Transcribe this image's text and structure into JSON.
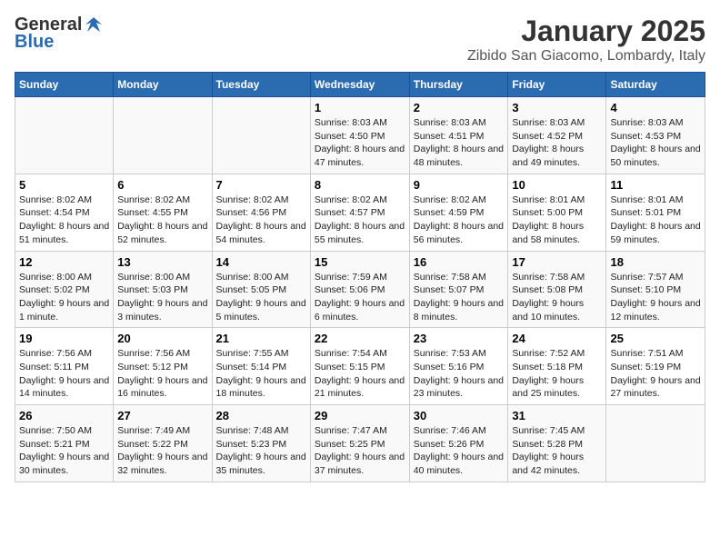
{
  "logo": {
    "general": "General",
    "blue": "Blue"
  },
  "title": "January 2025",
  "subtitle": "Zibido San Giacomo, Lombardy, Italy",
  "days_of_week": [
    "Sunday",
    "Monday",
    "Tuesday",
    "Wednesday",
    "Thursday",
    "Friday",
    "Saturday"
  ],
  "weeks": [
    [
      {
        "num": "",
        "info": ""
      },
      {
        "num": "",
        "info": ""
      },
      {
        "num": "",
        "info": ""
      },
      {
        "num": "1",
        "info": "Sunrise: 8:03 AM\nSunset: 4:50 PM\nDaylight: 8 hours and 47 minutes."
      },
      {
        "num": "2",
        "info": "Sunrise: 8:03 AM\nSunset: 4:51 PM\nDaylight: 8 hours and 48 minutes."
      },
      {
        "num": "3",
        "info": "Sunrise: 8:03 AM\nSunset: 4:52 PM\nDaylight: 8 hours and 49 minutes."
      },
      {
        "num": "4",
        "info": "Sunrise: 8:03 AM\nSunset: 4:53 PM\nDaylight: 8 hours and 50 minutes."
      }
    ],
    [
      {
        "num": "5",
        "info": "Sunrise: 8:02 AM\nSunset: 4:54 PM\nDaylight: 8 hours and 51 minutes."
      },
      {
        "num": "6",
        "info": "Sunrise: 8:02 AM\nSunset: 4:55 PM\nDaylight: 8 hours and 52 minutes."
      },
      {
        "num": "7",
        "info": "Sunrise: 8:02 AM\nSunset: 4:56 PM\nDaylight: 8 hours and 54 minutes."
      },
      {
        "num": "8",
        "info": "Sunrise: 8:02 AM\nSunset: 4:57 PM\nDaylight: 8 hours and 55 minutes."
      },
      {
        "num": "9",
        "info": "Sunrise: 8:02 AM\nSunset: 4:59 PM\nDaylight: 8 hours and 56 minutes."
      },
      {
        "num": "10",
        "info": "Sunrise: 8:01 AM\nSunset: 5:00 PM\nDaylight: 8 hours and 58 minutes."
      },
      {
        "num": "11",
        "info": "Sunrise: 8:01 AM\nSunset: 5:01 PM\nDaylight: 8 hours and 59 minutes."
      }
    ],
    [
      {
        "num": "12",
        "info": "Sunrise: 8:00 AM\nSunset: 5:02 PM\nDaylight: 9 hours and 1 minute."
      },
      {
        "num": "13",
        "info": "Sunrise: 8:00 AM\nSunset: 5:03 PM\nDaylight: 9 hours and 3 minutes."
      },
      {
        "num": "14",
        "info": "Sunrise: 8:00 AM\nSunset: 5:05 PM\nDaylight: 9 hours and 5 minutes."
      },
      {
        "num": "15",
        "info": "Sunrise: 7:59 AM\nSunset: 5:06 PM\nDaylight: 9 hours and 6 minutes."
      },
      {
        "num": "16",
        "info": "Sunrise: 7:58 AM\nSunset: 5:07 PM\nDaylight: 9 hours and 8 minutes."
      },
      {
        "num": "17",
        "info": "Sunrise: 7:58 AM\nSunset: 5:08 PM\nDaylight: 9 hours and 10 minutes."
      },
      {
        "num": "18",
        "info": "Sunrise: 7:57 AM\nSunset: 5:10 PM\nDaylight: 9 hours and 12 minutes."
      }
    ],
    [
      {
        "num": "19",
        "info": "Sunrise: 7:56 AM\nSunset: 5:11 PM\nDaylight: 9 hours and 14 minutes."
      },
      {
        "num": "20",
        "info": "Sunrise: 7:56 AM\nSunset: 5:12 PM\nDaylight: 9 hours and 16 minutes."
      },
      {
        "num": "21",
        "info": "Sunrise: 7:55 AM\nSunset: 5:14 PM\nDaylight: 9 hours and 18 minutes."
      },
      {
        "num": "22",
        "info": "Sunrise: 7:54 AM\nSunset: 5:15 PM\nDaylight: 9 hours and 21 minutes."
      },
      {
        "num": "23",
        "info": "Sunrise: 7:53 AM\nSunset: 5:16 PM\nDaylight: 9 hours and 23 minutes."
      },
      {
        "num": "24",
        "info": "Sunrise: 7:52 AM\nSunset: 5:18 PM\nDaylight: 9 hours and 25 minutes."
      },
      {
        "num": "25",
        "info": "Sunrise: 7:51 AM\nSunset: 5:19 PM\nDaylight: 9 hours and 27 minutes."
      }
    ],
    [
      {
        "num": "26",
        "info": "Sunrise: 7:50 AM\nSunset: 5:21 PM\nDaylight: 9 hours and 30 minutes."
      },
      {
        "num": "27",
        "info": "Sunrise: 7:49 AM\nSunset: 5:22 PM\nDaylight: 9 hours and 32 minutes."
      },
      {
        "num": "28",
        "info": "Sunrise: 7:48 AM\nSunset: 5:23 PM\nDaylight: 9 hours and 35 minutes."
      },
      {
        "num": "29",
        "info": "Sunrise: 7:47 AM\nSunset: 5:25 PM\nDaylight: 9 hours and 37 minutes."
      },
      {
        "num": "30",
        "info": "Sunrise: 7:46 AM\nSunset: 5:26 PM\nDaylight: 9 hours and 40 minutes."
      },
      {
        "num": "31",
        "info": "Sunrise: 7:45 AM\nSunset: 5:28 PM\nDaylight: 9 hours and 42 minutes."
      },
      {
        "num": "",
        "info": ""
      }
    ]
  ]
}
